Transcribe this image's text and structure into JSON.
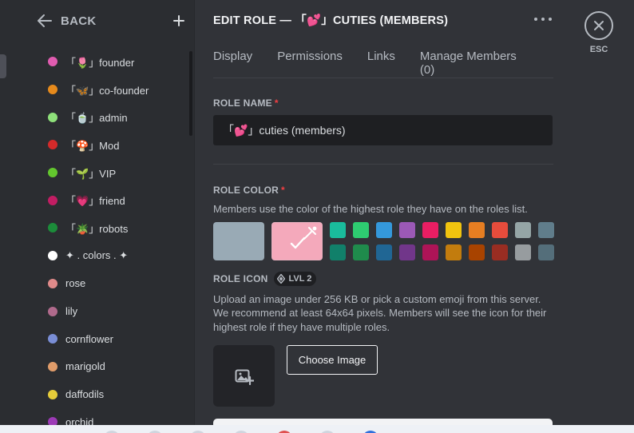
{
  "sidebar": {
    "back_label": "BACK",
    "roles": [
      {
        "name": "「🌷」founder",
        "color": "#e05cb0"
      },
      {
        "name": "「🦋」co-founder",
        "color": "#e68a1c"
      },
      {
        "name": "「🍵」admin",
        "color": "#8ee07a"
      },
      {
        "name": "「🍄」Mod",
        "color": "#d42a2a"
      },
      {
        "name": "「🌱」VIP",
        "color": "#63c72e"
      },
      {
        "name": "「💗」friend",
        "color": "#c21d63"
      },
      {
        "name": "「🪴」robots",
        "color": "#1c8c3a"
      },
      {
        "name": "✦ .  colors . ✦",
        "color": "#ffffff"
      },
      {
        "name": "rose",
        "color": "#e08a8a"
      },
      {
        "name": "lily",
        "color": "#b06a8c"
      },
      {
        "name": "cornflower",
        "color": "#7a8ed6"
      },
      {
        "name": "marigold",
        "color": "#e09c6a"
      },
      {
        "name": "daffodils",
        "color": "#e6cc3a"
      },
      {
        "name": "orchid",
        "color": "#9c3ab6"
      }
    ]
  },
  "header": {
    "title": "EDIT ROLE — 「💕」CUTIES (MEMBERS)",
    "tabs": [
      {
        "label": "Display",
        "active": true
      },
      {
        "label": "Permissions",
        "active": false
      },
      {
        "label": "Links",
        "active": false
      },
      {
        "label": "Manage Members (0)",
        "active": false
      }
    ]
  },
  "role_name": {
    "label": "ROLE NAME",
    "required_mark": "*",
    "value": "「💕」cuties (members)"
  },
  "role_color": {
    "label": "ROLE COLOR",
    "required_mark": "*",
    "description": "Members use the color of the highest role they have on the roles list.",
    "default_color": "#99aab5",
    "custom_color": "#f4a9bb",
    "palette": [
      "#1abc9c",
      "#2ecc71",
      "#3498db",
      "#9b59b6",
      "#e91e63",
      "#f1c40f",
      "#e67e22",
      "#e74c3c",
      "#95a5a6",
      "#607d8b",
      "#11806a",
      "#1f8b4c",
      "#206694",
      "#71368a",
      "#ad1457",
      "#c27c0e",
      "#a84300",
      "#992d22",
      "#979c9f",
      "#546e7a"
    ]
  },
  "role_icon": {
    "label": "ROLE ICON",
    "badge": "LVL 2",
    "description": "Upload an image under 256 KB or pick a custom emoji from this server. We recommend at least 64x64 pixels. Members will see the icon for their highest role if they have multiple roles.",
    "choose_button": "Choose Image"
  },
  "close": {
    "label": "ESC"
  },
  "colors": {
    "accent": "#949cf7",
    "required": "#f23f43",
    "background": "#313338",
    "sidebar": "#2b2d31"
  },
  "icons": {
    "back": "arrow-left-icon",
    "add": "plus-icon",
    "more": "ellipsis-icon",
    "close": "close-icon",
    "badge": "boost-gem-icon",
    "upload": "image-add-icon",
    "custom_color": "eyedropper-icon"
  }
}
